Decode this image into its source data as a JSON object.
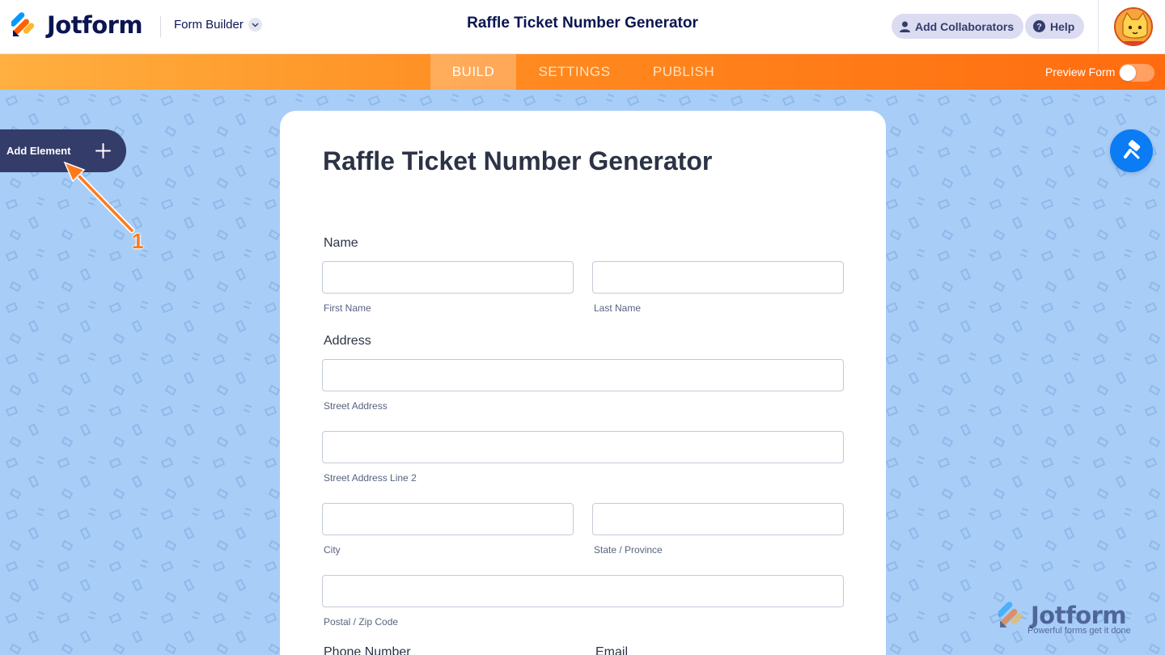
{
  "header": {
    "logo_text": "Jotform",
    "builder_label": "Form Builder",
    "form_title": "Raffle Ticket Number Generator",
    "collaborators_label": "Add Collaborators",
    "help_label": "Help"
  },
  "nav": {
    "tabs": [
      {
        "label": "BUILD",
        "active": true
      },
      {
        "label": "SETTINGS",
        "active": false
      },
      {
        "label": "PUBLISH",
        "active": false
      }
    ],
    "preview_label": "Preview Form",
    "preview_on": false
  },
  "sidebar": {
    "add_element_label": "Add Element",
    "annotation_number": "1"
  },
  "form": {
    "heading": "Raffle Ticket Number Generator",
    "name": {
      "label": "Name",
      "first_sublabel": "First Name",
      "last_sublabel": "Last Name",
      "first_value": "",
      "last_value": ""
    },
    "address": {
      "label": "Address",
      "street_sublabel": "Street Address",
      "street2_sublabel": "Street Address Line 2",
      "city_sublabel": "City",
      "state_sublabel": "State / Province",
      "postal_sublabel": "Postal / Zip Code"
    },
    "phone_label": "Phone Number",
    "email_label": "Email"
  },
  "watermark": {
    "logo_text": "Jotform",
    "tagline": "Powerful forms get it done"
  },
  "colors": {
    "brand_navy": "#0a1551",
    "nav_orange": "#ff6c10",
    "canvas_blue": "#a8cdf7",
    "accent_blue": "#0b7cf3",
    "annotation_orange": "#ff7a1a"
  }
}
